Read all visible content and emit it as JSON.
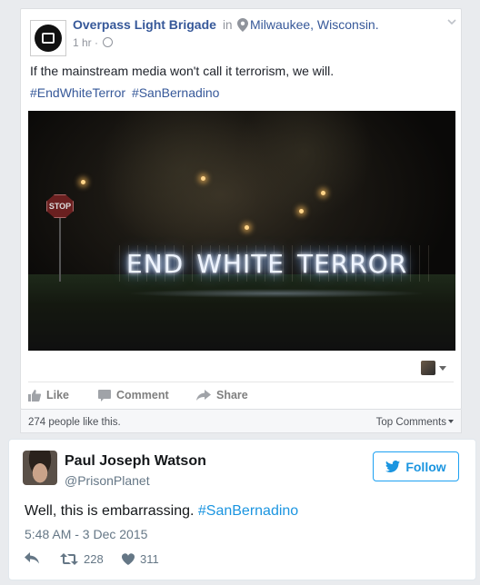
{
  "facebook_post": {
    "page_name": "Overpass Light Brigade",
    "in_word": "in",
    "location": "Milwaukee, Wisconsin.",
    "time": "1 hr ·",
    "text": "If the mainstream media won't call it terrorism, we will.",
    "hashtags": [
      "#EndWhiteTerror",
      "#SanBernadino"
    ],
    "photo": {
      "stop_sign": "STOP",
      "light_sign_words": [
        "END",
        "WHITE",
        "TERROR"
      ]
    },
    "actions": [
      {
        "label": "Like",
        "icon": "thumbs-up-icon"
      },
      {
        "label": "Comment",
        "icon": "comment-icon"
      },
      {
        "label": "Share",
        "icon": "share-arrow-icon"
      }
    ],
    "likes_text": "274 people like this.",
    "sort_label": "Top Comments"
  },
  "tweet": {
    "name": "Paul Joseph Watson",
    "handle": "@PrisonPlanet",
    "follow_label": "Follow",
    "text_prefix": "Well, this is embarrassing.",
    "hashtag": "#SanBernadino",
    "timestamp": "5:48 AM - 3 Dec 2015",
    "retweets": "228",
    "likes": "311"
  },
  "colors": {
    "facebook_link": "#365899",
    "twitter_blue": "#1da1f2",
    "muted": "#90949c"
  }
}
